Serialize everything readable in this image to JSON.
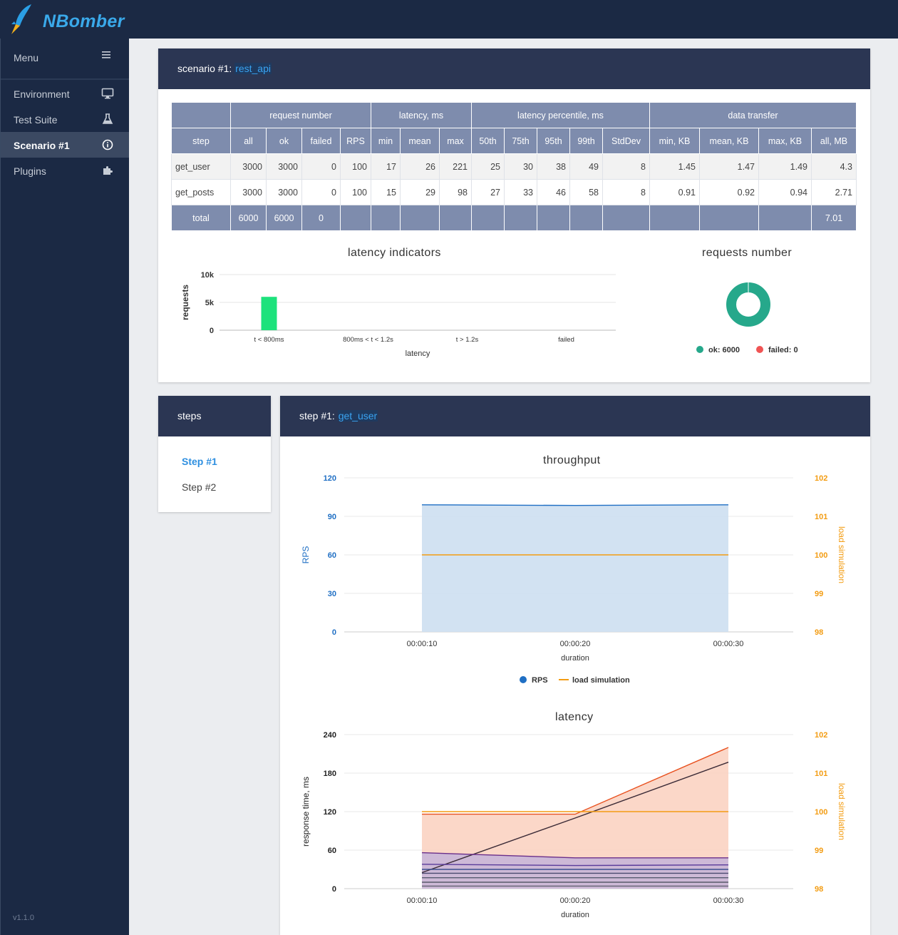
{
  "app": {
    "brand": "NBomber",
    "version": "v1.1.0"
  },
  "sidebar": {
    "menu_label": "Menu",
    "items": [
      {
        "label": "Environment",
        "icon": "monitor-icon"
      },
      {
        "label": "Test Suite",
        "icon": "flask-icon"
      },
      {
        "label": "Scenario #1",
        "icon": "info-icon",
        "active": true
      },
      {
        "label": "Plugins",
        "icon": "puzzle-icon"
      }
    ]
  },
  "scenario": {
    "prefix": "scenario #1: ",
    "name": "rest_api",
    "table": {
      "group_headers": [
        "request number",
        "latency, ms",
        "latency percentile, ms",
        "data transfer"
      ],
      "columns": [
        "step",
        "all",
        "ok",
        "failed",
        "RPS",
        "min",
        "mean",
        "max",
        "50th",
        "75th",
        "95th",
        "99th",
        "StdDev",
        "min, KB",
        "mean, KB",
        "max, KB",
        "all, MB"
      ],
      "rows": [
        [
          "get_user",
          "3000",
          "3000",
          "0",
          "100",
          "17",
          "26",
          "221",
          "25",
          "30",
          "38",
          "49",
          "8",
          "1.45",
          "1.47",
          "1.49",
          "4.3"
        ],
        [
          "get_posts",
          "3000",
          "3000",
          "0",
          "100",
          "15",
          "29",
          "98",
          "27",
          "33",
          "46",
          "58",
          "8",
          "0.91",
          "0.92",
          "0.94",
          "2.71"
        ]
      ],
      "total": [
        "total",
        "6000",
        "6000",
        "0",
        "",
        "",
        "",
        "",
        "",
        "",
        "",
        "",
        "",
        "",
        "",
        "",
        "7.01"
      ]
    }
  },
  "steps_panel": {
    "title": "steps",
    "items": [
      "Step #1",
      "Step #2"
    ],
    "active_index": 0
  },
  "step_panel": {
    "prefix": "step #1: ",
    "name": "get_user"
  },
  "chart_data": [
    {
      "type": "bar",
      "title": "latency indicators",
      "xlabel": "latency",
      "ylabel": "requests",
      "categories": [
        "t < 800ms",
        "800ms < t < 1.2s",
        "t > 1.2s",
        "failed"
      ],
      "values": [
        6000,
        0,
        0,
        0
      ],
      "ylim": [
        0,
        10000
      ],
      "yticks": [
        "0",
        "5k",
        "10k"
      ],
      "ytick_values": [
        0,
        5000,
        10000
      ],
      "color": "#1de27c"
    },
    {
      "type": "pie",
      "title": "requests number",
      "labels": [
        "ok",
        "failed"
      ],
      "values": [
        6000,
        0
      ],
      "legend": [
        "ok: 6000",
        "failed: 0"
      ],
      "colors": [
        "#26a88b",
        "#f05454"
      ]
    },
    {
      "type": "area",
      "title": "throughput",
      "xlabel": "duration",
      "ylabel": "RPS",
      "y2label": "load simulation",
      "x": [
        "00:00:10",
        "00:00:20",
        "00:00:30"
      ],
      "ylim": [
        0,
        120
      ],
      "yticks": [
        0,
        30,
        60,
        90,
        120
      ],
      "y2lim": [
        98,
        102
      ],
      "y2ticks": [
        98,
        99,
        100,
        101,
        102
      ],
      "series": [
        {
          "name": "RPS",
          "axis": "left",
          "values": [
            99,
            98.5,
            99
          ],
          "color": "#1f6fc4",
          "fill": "#cddff1"
        },
        {
          "name": "load simulation",
          "axis": "right",
          "values": [
            100,
            100,
            100
          ],
          "color": "#f39c12"
        }
      ],
      "legend": [
        "RPS",
        "load simulation"
      ]
    },
    {
      "type": "area",
      "title": "latency",
      "xlabel": "duration",
      "ylabel": "response time, ms",
      "y2label": "load simulation",
      "x": [
        "00:00:10",
        "00:00:20",
        "00:00:30"
      ],
      "ylim": [
        0,
        240
      ],
      "yticks": [
        0,
        60,
        120,
        180,
        240
      ],
      "y2lim": [
        98,
        102
      ],
      "y2ticks": [
        98,
        99,
        100,
        101,
        102
      ],
      "series": [
        {
          "axis": "left",
          "values": [
            116,
            116,
            220
          ],
          "color": "#e8501e",
          "fill": "#fbd3c2"
        },
        {
          "axis": "left",
          "values": [
            25,
            110,
            197
          ],
          "color": "#3a2a36"
        },
        {
          "axis": "left",
          "values": [
            56,
            48,
            48
          ],
          "color": "#6a2e8a",
          "fill": "#c8b6d8"
        },
        {
          "axis": "left",
          "values": [
            38,
            36,
            37
          ],
          "color": "#5a3c9a"
        },
        {
          "axis": "left",
          "values": [
            30,
            30,
            30
          ],
          "color": "#3d4f8f"
        },
        {
          "axis": "left",
          "values": [
            24,
            24,
            24
          ],
          "color": "#4a4a70"
        },
        {
          "axis": "left",
          "values": [
            17,
            17,
            17
          ],
          "color": "#555a70"
        },
        {
          "axis": "left",
          "values": [
            10,
            10,
            10
          ],
          "color": "#5a5a6a"
        },
        {
          "axis": "left",
          "values": [
            4,
            4,
            4
          ],
          "color": "#606070"
        },
        {
          "axis": "right",
          "values": [
            100,
            100,
            100
          ],
          "color": "#f39c12"
        }
      ]
    }
  ]
}
